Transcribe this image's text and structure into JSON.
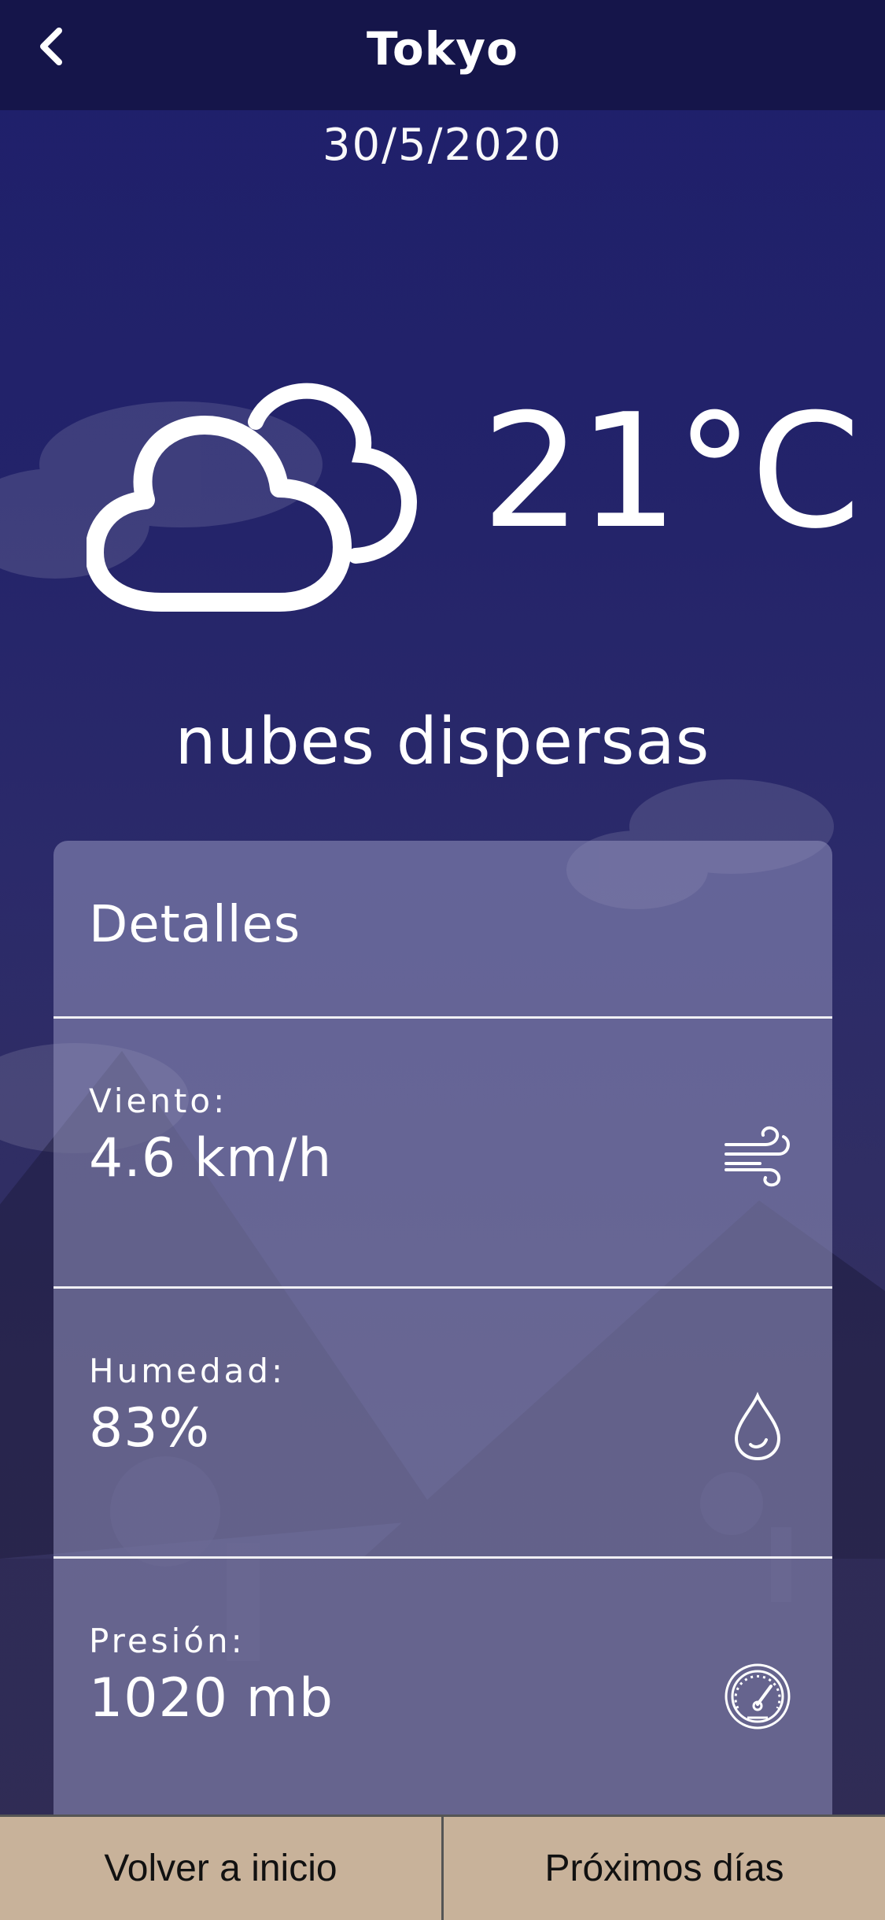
{
  "header": {
    "title": "Tokyo",
    "back_icon": "chevron-left-icon"
  },
  "date": "30/5/2020",
  "current": {
    "icon": "scattered-clouds-icon",
    "temperature": "21°C",
    "description": "nubes dispersas"
  },
  "details": {
    "title": "Detalles",
    "items": [
      {
        "label": "Viento:",
        "value": "4.6 km/h",
        "icon": "wind-icon"
      },
      {
        "label": "Humedad:",
        "value": "83%",
        "icon": "humidity-drop-icon"
      },
      {
        "label": "Presión:",
        "value": "1020 mb",
        "icon": "pressure-gauge-icon"
      }
    ]
  },
  "bottom_nav": {
    "home_label": "Volver a inicio",
    "next_days_label": "Próximos días"
  }
}
